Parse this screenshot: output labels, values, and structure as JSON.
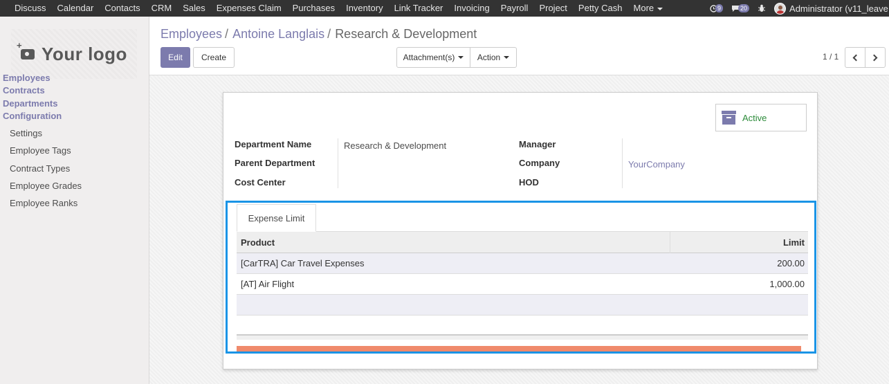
{
  "topbar": {
    "menu": [
      "Discuss",
      "Calendar",
      "Contacts",
      "CRM",
      "Sales",
      "Expenses Claim",
      "Purchases",
      "Inventory",
      "Link Tracker",
      "Invoicing",
      "Payroll",
      "Project",
      "Petty Cash",
      "More"
    ],
    "activity_count": "9",
    "message_count": "20",
    "user": "Administrator (v11_leave"
  },
  "sidebar": {
    "logo_text": "Your logo",
    "sections": [
      "Employees",
      "Contracts",
      "Departments",
      "Configuration"
    ],
    "config_items": [
      "Settings",
      "Employee Tags",
      "Contract Types",
      "Employee Grades",
      "Employee Ranks"
    ]
  },
  "breadcrumb": [
    "Employees",
    "Antoine Langlais",
    "Research & Development"
  ],
  "buttons": {
    "edit": "Edit",
    "create": "Create",
    "attachments": "Attachment(s)",
    "action": "Action"
  },
  "pager": {
    "value": "1 / 1"
  },
  "form": {
    "active_label": "Active",
    "labels": {
      "department_name": "Department Name",
      "parent_department": "Parent Department",
      "cost_center": "Cost Center",
      "manager": "Manager",
      "company": "Company",
      "hod": "HOD"
    },
    "values": {
      "department_name": "Research & Development",
      "company": "YourCompany"
    }
  },
  "notebook": {
    "tab": "Expense Limit",
    "headers": [
      "Product",
      "Limit"
    ],
    "rows": [
      {
        "product": "[CarTRA] Car Travel Expenses",
        "limit": "200.00"
      },
      {
        "product": "[AT] Air Flight",
        "limit": "1,000.00"
      }
    ]
  },
  "colors": {
    "brand": "#7c7bad",
    "active": "#2c8b3a",
    "highlight": "#1a94e6",
    "topbar": "#333333"
  }
}
